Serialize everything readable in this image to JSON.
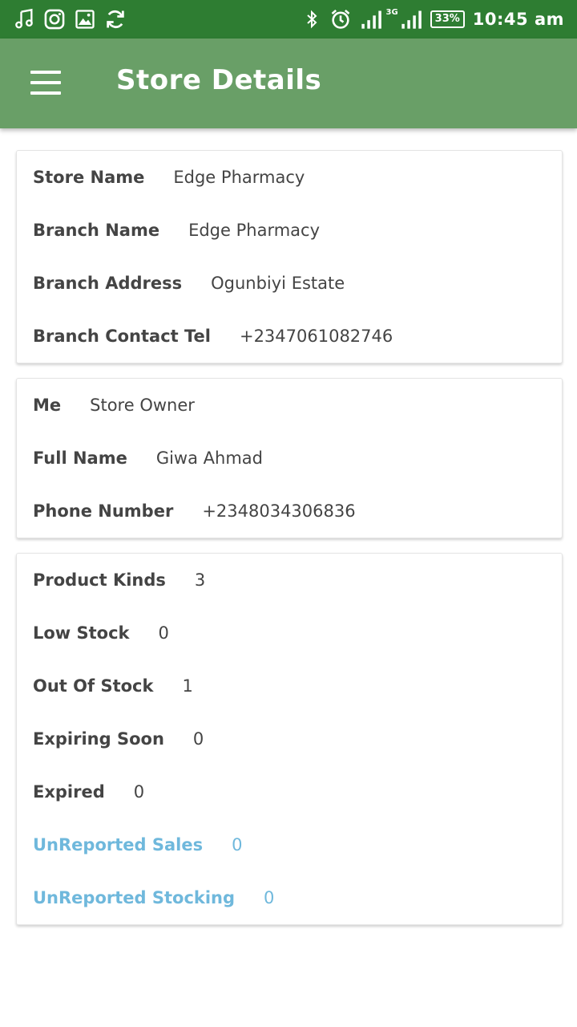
{
  "status_bar": {
    "left_icons": [
      "music-note-icon",
      "instagram-icon",
      "image-icon",
      "sync-icon"
    ],
    "right_icons": [
      "bluetooth-icon",
      "alarm-icon",
      "signal-icon",
      "3g-signal-icon"
    ],
    "network": "3G",
    "battery": "33%",
    "time": "10:45 am"
  },
  "app_bar": {
    "title": "Store Details",
    "menu_icon": "hamburger-menu-icon",
    "color": "#699f67"
  },
  "store_card": {
    "rows": [
      {
        "label": "Store Name",
        "value": "Edge Pharmacy"
      },
      {
        "label": "Branch Name",
        "value": "Edge Pharmacy"
      },
      {
        "label": "Branch Address",
        "value": "Ogunbiyi Estate"
      },
      {
        "label": "Branch Contact Tel",
        "value": "+2347061082746"
      }
    ]
  },
  "user_card": {
    "rows": [
      {
        "label": "Me",
        "value": "Store Owner"
      },
      {
        "label": "Full Name",
        "value": "Giwa Ahmad"
      },
      {
        "label": "Phone Number",
        "value": "+2348034306836"
      }
    ]
  },
  "stock_card": {
    "rows": [
      {
        "label": "Product Kinds",
        "value": "3"
      },
      {
        "label": "Low Stock",
        "value": "0"
      },
      {
        "label": "Out Of Stock",
        "value": "1"
      },
      {
        "label": "Expiring Soon",
        "value": "0"
      },
      {
        "label": "Expired",
        "value": "0"
      },
      {
        "label": "UnReported Sales",
        "value": "0"
      },
      {
        "label": "UnReported Stocking",
        "value": "0"
      }
    ],
    "link_color": "#6fb8dc"
  }
}
